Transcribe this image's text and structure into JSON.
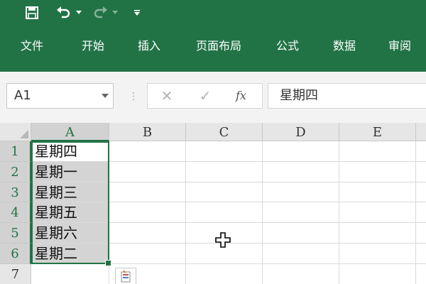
{
  "quick_access": {
    "save_icon": "save-icon",
    "undo_icon": "undo-icon",
    "redo_icon": "redo-icon",
    "customize_icon": "customize-qat-icon"
  },
  "menu_tabs": [
    "文件",
    "开始",
    "插入",
    "页面布局",
    "公式",
    "数据",
    "审阅"
  ],
  "formula_bar": {
    "name_box": "A1",
    "fx_label": "fx",
    "value": "星期四"
  },
  "grid": {
    "columns": [
      "A",
      "B",
      "C",
      "D",
      "E"
    ],
    "rows": [
      "1",
      "2",
      "3",
      "4",
      "5",
      "6",
      "7"
    ],
    "column_a_values": [
      "星期四",
      "星期一",
      "星期三",
      "星期五",
      "星期六",
      "星期二",
      ""
    ]
  },
  "colors": {
    "ribbon": "#217346",
    "selection_fill": "#d4d4d4",
    "selection_border": "#217346"
  }
}
